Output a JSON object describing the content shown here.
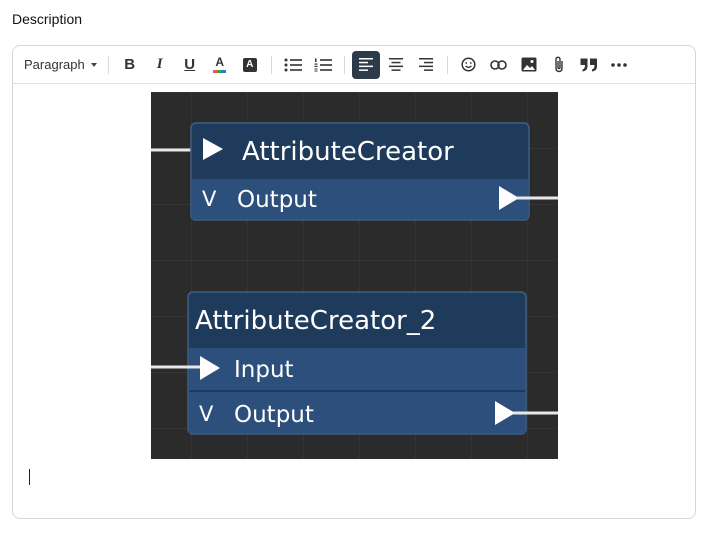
{
  "field": {
    "label": "Description"
  },
  "toolbar": {
    "block_format": "Paragraph",
    "bold_label": "B",
    "italic_label": "I",
    "underline_label": "U",
    "font_color_label": "A",
    "highlight_label": "A",
    "font_color_swatch": "#d9534f",
    "active_bg": "#2d3a4a",
    "icons": [
      "bullet-list-icon",
      "numbered-list-icon",
      "align-left-icon",
      "align-center-icon",
      "align-right-icon",
      "emoji-icon",
      "link-icon",
      "image-icon",
      "attachment-icon",
      "quote-icon",
      "more-icon"
    ]
  },
  "image": {
    "background": "#2b2b2b",
    "node_header_color": "#1f3b5c",
    "node_row_color": "#2c4f7c",
    "node1": {
      "title": "AttributeCreator",
      "output_label": "Output",
      "expand_glyph": "V"
    },
    "node2": {
      "title": "AttributeCreator_2",
      "input_label": "Input",
      "output_label": "Output",
      "expand_glyph": "V"
    }
  }
}
